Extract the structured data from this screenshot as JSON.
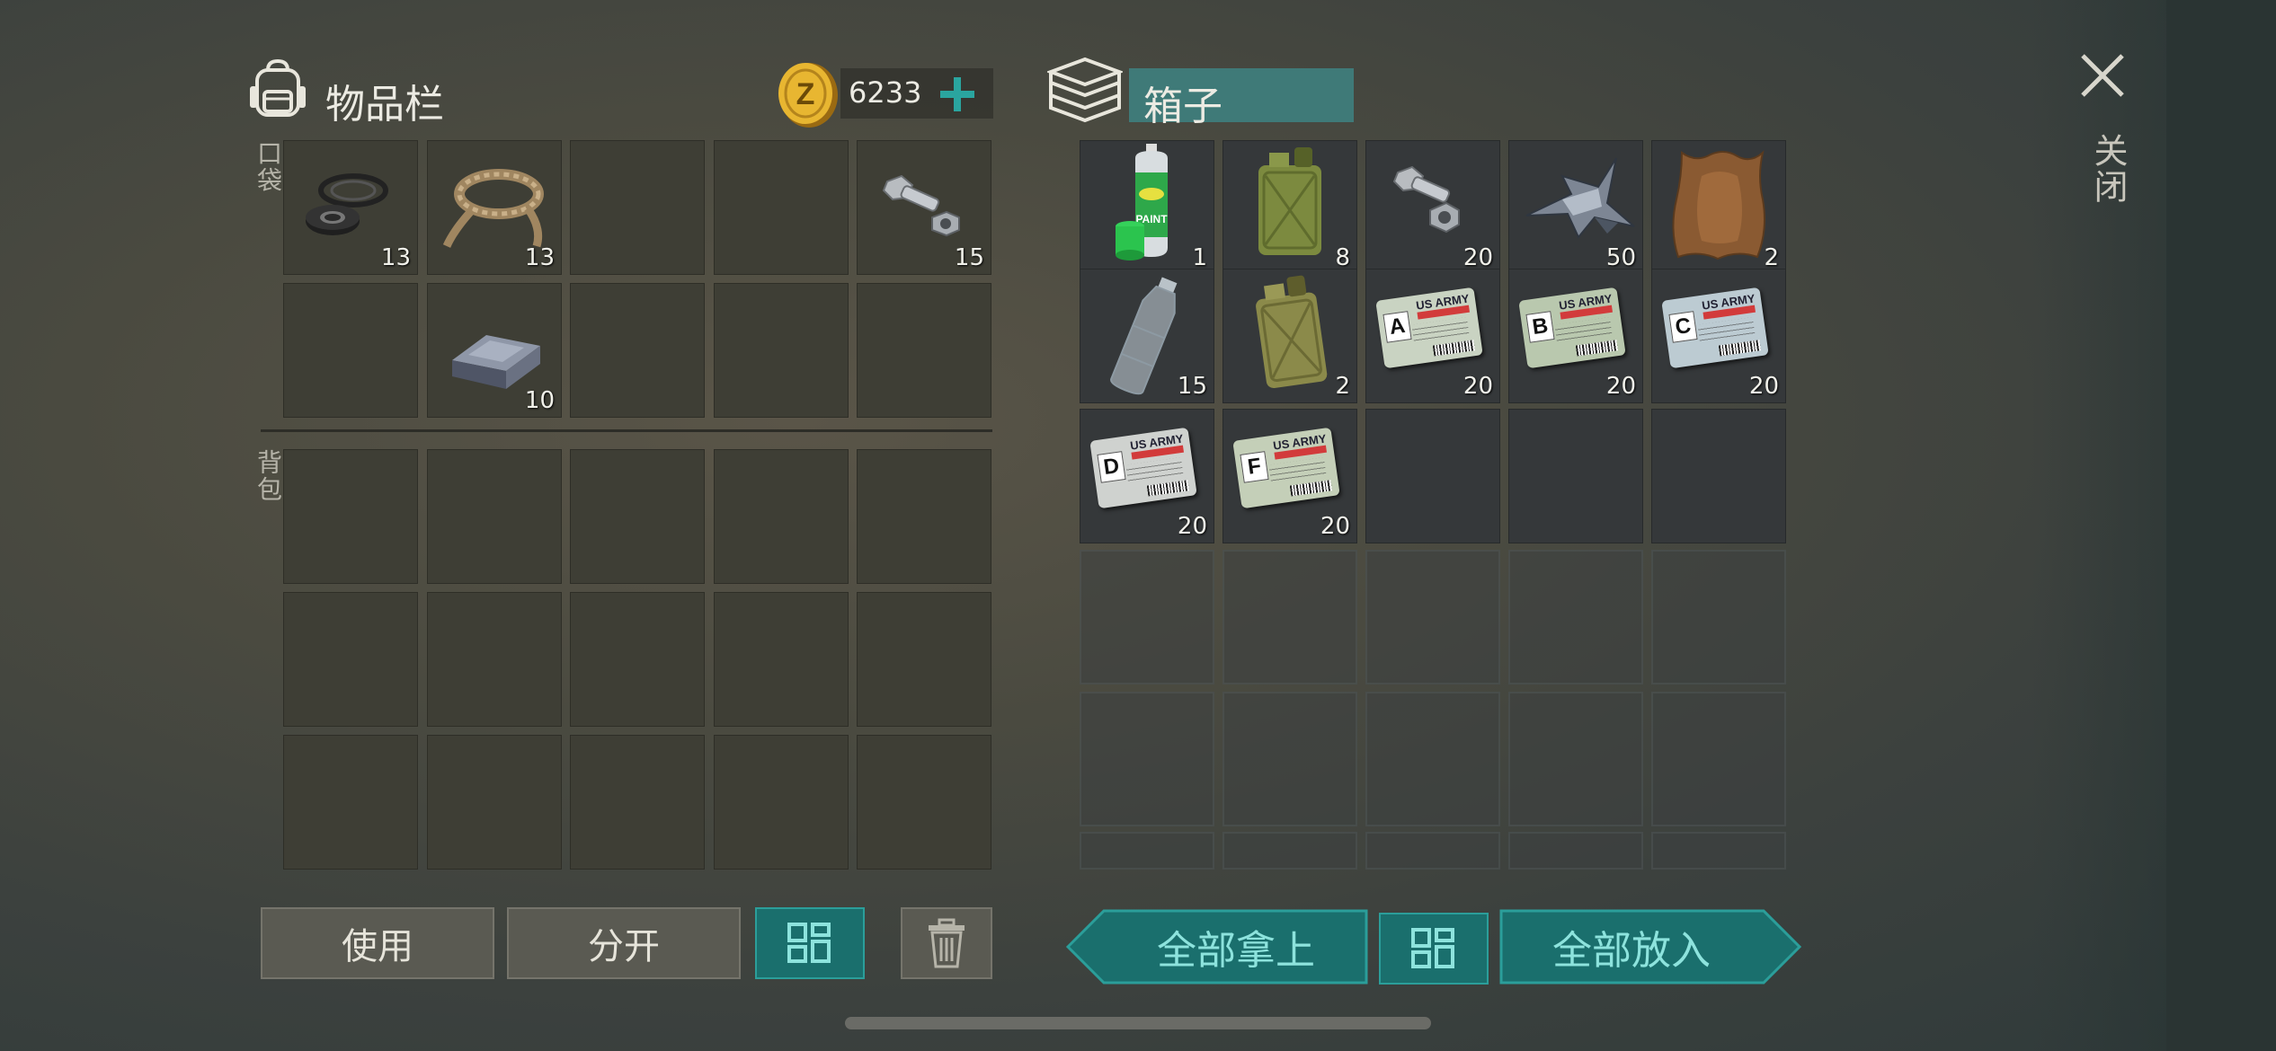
{
  "inventory": {
    "title": "物品栏",
    "coins": "6233",
    "pocket_label": "口袋",
    "backpack_label": "背包",
    "pocket_items": [
      {
        "name": "washers",
        "qty": "13"
      },
      {
        "name": "rope",
        "qty": "13"
      },
      {
        "name": "",
        "qty": ""
      },
      {
        "name": "",
        "qty": ""
      },
      {
        "name": "bolts",
        "qty": "15"
      },
      {
        "name": "",
        "qty": ""
      },
      {
        "name": "iron-ingot",
        "qty": "10"
      },
      {
        "name": "",
        "qty": ""
      },
      {
        "name": "",
        "qty": ""
      },
      {
        "name": "",
        "qty": ""
      }
    ]
  },
  "box": {
    "title": "箱子",
    "items": [
      {
        "name": "spray-paint",
        "qty": "1"
      },
      {
        "name": "jerrycan",
        "qty": "8"
      },
      {
        "name": "bolts",
        "qty": "20"
      },
      {
        "name": "metal-scrap",
        "qty": "50"
      },
      {
        "name": "leather-hide",
        "qty": "2"
      },
      {
        "name": "plastic-bottle",
        "qty": "15"
      },
      {
        "name": "jerrycan-old",
        "qty": "2"
      },
      {
        "name": "army-card-a",
        "qty": "20",
        "letter": "A",
        "color": "#c9d3c2"
      },
      {
        "name": "army-card-b",
        "qty": "20",
        "letter": "B",
        "color": "#b9c8ae"
      },
      {
        "name": "army-card-c",
        "qty": "20",
        "letter": "C",
        "color": "#bccbd2"
      },
      {
        "name": "army-card-d",
        "qty": "20",
        "letter": "D",
        "color": "#cfd2cf"
      },
      {
        "name": "army-card-f",
        "qty": "20",
        "letter": "F",
        "color": "#c4cfb8"
      }
    ],
    "card_header": "US ARMY"
  },
  "close_label": "关闭",
  "buttons": {
    "use": "使用",
    "split": "分开",
    "take_all": "全部拿上",
    "put_all": "全部放入"
  },
  "colors": {
    "accent": "#1a6f6d",
    "accent_text": "#8de3dd",
    "coin": "#e8b631"
  }
}
